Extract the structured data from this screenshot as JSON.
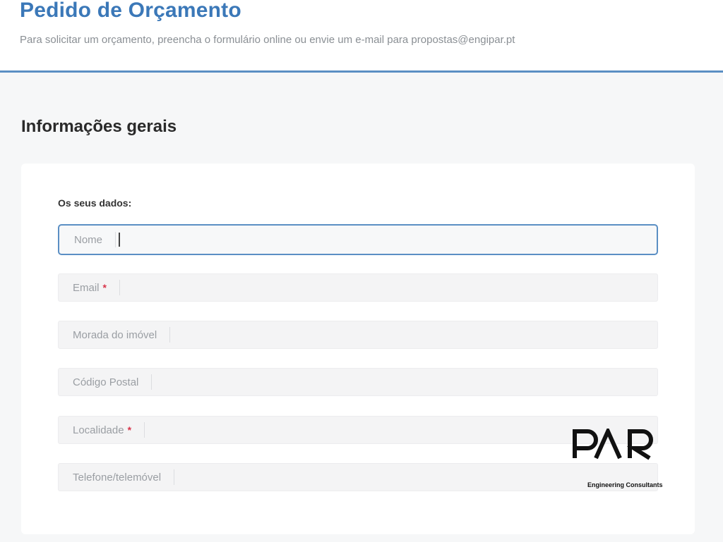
{
  "header": {
    "title": "Pedido de Orçamento",
    "subtitle": "Para solicitar um orçamento, preencha o formulário online ou envie um e-mail para propostas@engipar.pt"
  },
  "section": {
    "title": "Informações gerais"
  },
  "form": {
    "group_label": "Os seus dados:",
    "required_mark": "*",
    "fields": [
      {
        "label": "Nome",
        "required": false,
        "value": "",
        "focused": true
      },
      {
        "label": "Email",
        "required": true,
        "value": ""
      },
      {
        "label": "Morada do imóvel",
        "required": false,
        "value": ""
      },
      {
        "label": "Código Postal",
        "required": false,
        "value": ""
      },
      {
        "label": "Localidade",
        "required": true,
        "value": ""
      },
      {
        "label": "Telefone/telemóvel",
        "required": false,
        "value": ""
      }
    ]
  },
  "logo": {
    "wordmark": "PAR",
    "tagline": "Engineering Consultants"
  },
  "colors": {
    "accent": "#3b78b8",
    "focus_border": "#5b8fc4",
    "required": "#d8344a",
    "background": "#f6f7f8"
  }
}
